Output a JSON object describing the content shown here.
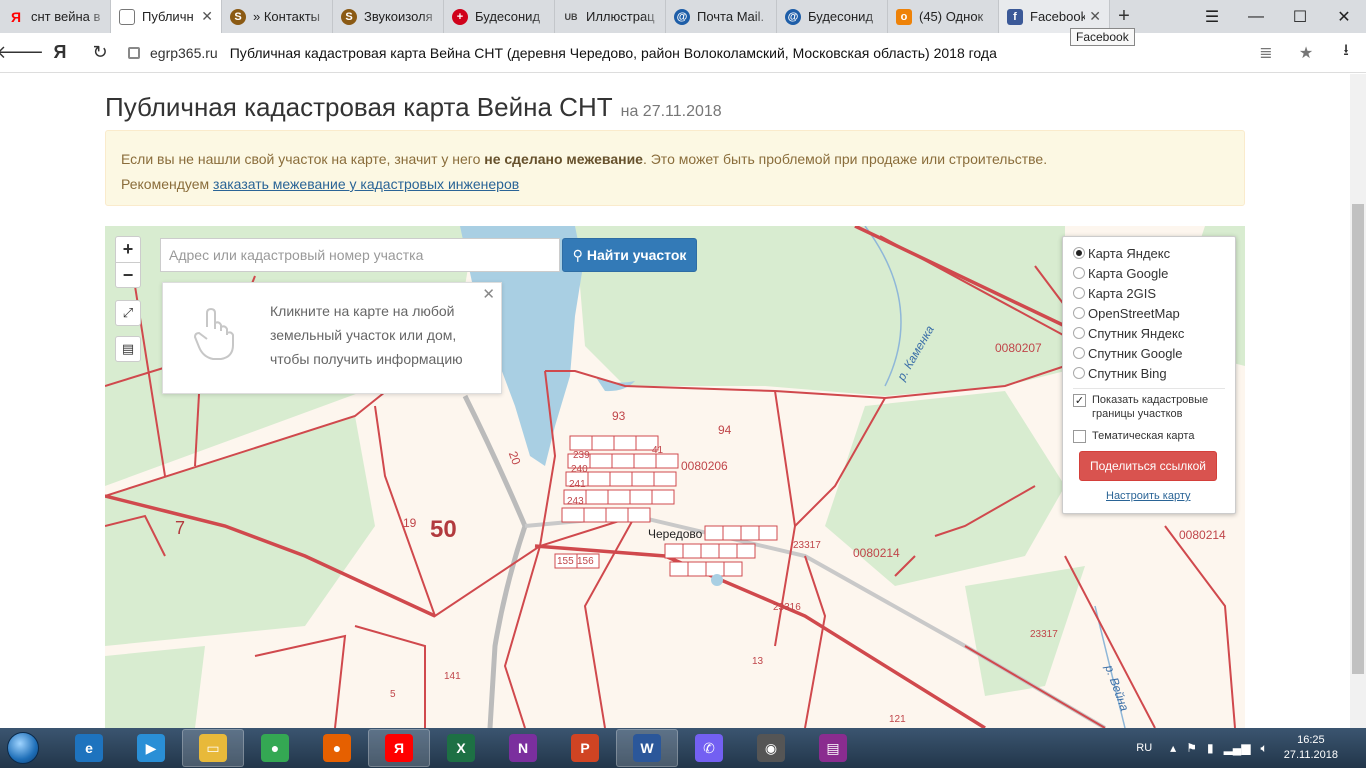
{
  "browser": {
    "tabs": [
      {
        "label": "снт вейна в",
        "icon": "yandex-icon",
        "color": "#ff0000"
      },
      {
        "label": "Публичн",
        "icon": "page-icon",
        "color": "#777777",
        "active": true
      },
      {
        "label": "» Контакты",
        "icon": "s-icon",
        "color": "#8b5a14"
      },
      {
        "label": "Звукоизоля",
        "icon": "s-icon",
        "color": "#8b5a14"
      },
      {
        "label": "Будесонид",
        "icon": "red-cross-icon",
        "color": "#d0021b"
      },
      {
        "label": "Иллюстрац",
        "icon": "ub-icon",
        "color": "#444444"
      },
      {
        "label": "Почта Mail.",
        "icon": "mail-icon",
        "color": "#1e5ea8"
      },
      {
        "label": "Будесонид",
        "icon": "mail-icon",
        "color": "#1e5ea8"
      },
      {
        "label": "(45) Однок",
        "icon": "ok-icon",
        "color": "#ee8208"
      },
      {
        "label": "Facebook",
        "icon": "facebook-icon",
        "color": "#3b5998"
      }
    ],
    "tooltip": "Facebook",
    "url_domain": "egrp365.ru",
    "url_title": "Публичная кадастровая карта Вейна СНТ (деревня Чередово, район Волоколамский, Московская область) 2018 года"
  },
  "page": {
    "title": "Публичная кадастровая карта Вейна СНТ",
    "date": "на 27.11.2018",
    "notice": {
      "line1_pre": "Если вы не нашли свой участок на карте, значит у него ",
      "line1_bold": "не сделано межевание",
      "line1_post": ". Это может быть проблемой при продаже или строительстве.",
      "line2_pre": "Рекомендуем ",
      "line2_link": "заказать межевание у кадастровых инженеров"
    }
  },
  "map": {
    "search_placeholder": "Адрес или кадастровый номер участка",
    "search_button": "Найти участок",
    "hint_text": "Кликните на карте на любой земельный участок или дом, чтобы получить информацию",
    "layers": [
      {
        "label": "Карта Яндекс",
        "selected": true
      },
      {
        "label": "Карта Google",
        "selected": false
      },
      {
        "label": "Карта 2GIS",
        "selected": false
      },
      {
        "label": "OpenStreetMap",
        "selected": false
      },
      {
        "label": "Спутник Яндекс",
        "selected": false
      },
      {
        "label": "Спутник Google",
        "selected": false
      },
      {
        "label": "Спутник Bing",
        "selected": false
      }
    ],
    "show_cadastral": "Показать кадастровые границы участков",
    "show_cadastral_checked": true,
    "thematic": "Тематическая карта",
    "thematic_checked": false,
    "share_button": "Поделиться ссылкой",
    "setup_link": "Настроить карту",
    "labels": {
      "l_0080207": "0080207",
      "l_0080206": "0080206",
      "l_0080214a": "0080214",
      "l_0080214b": "0080214",
      "l_50": "50",
      "l_7": "7",
      "l_19": "19",
      "l_93": "93",
      "l_94": "94",
      "l_20": "20",
      "l_239": "239",
      "l_240": "240",
      "l_241": "241",
      "l_243": "243",
      "l_41": "41",
      "l_155": "155",
      "l_156": "156",
      "l_23317a": "23317",
      "l_23317b": "23317",
      "l_23316": "23316",
      "l_13": "13",
      "l_141": "141",
      "l_5": "5",
      "l_121": "121",
      "village": "Чередово",
      "river_kamenka": "р. Каменка",
      "river_veyna": "р. Вейна"
    }
  },
  "taskbar": {
    "lang": "RU",
    "time": "16:25",
    "date": "27.11.2018",
    "apps": [
      {
        "name": "internet-explorer-icon",
        "color": "#1e73be",
        "glyph": "e"
      },
      {
        "name": "media-player-icon",
        "color": "#2a8fd6",
        "glyph": "▶"
      },
      {
        "name": "file-explorer-icon",
        "color": "#e8b93a",
        "glyph": "▭",
        "active": true
      },
      {
        "name": "chrome-icon",
        "color": "#34a853",
        "glyph": "●"
      },
      {
        "name": "firefox-icon",
        "color": "#e66000",
        "glyph": "●"
      },
      {
        "name": "yandex-browser-icon",
        "color": "#ff0000",
        "glyph": "Я",
        "active": true
      },
      {
        "name": "excel-icon",
        "color": "#1d7044",
        "glyph": "X"
      },
      {
        "name": "onenote-icon",
        "color": "#7b2f9e",
        "glyph": "N"
      },
      {
        "name": "powerpoint-icon",
        "color": "#d04423",
        "glyph": "P"
      },
      {
        "name": "word-icon",
        "color": "#2b579a",
        "glyph": "W",
        "active": true
      },
      {
        "name": "viber-icon",
        "color": "#7360f2",
        "glyph": "✆"
      },
      {
        "name": "camera-icon",
        "color": "#555555",
        "glyph": "◉"
      },
      {
        "name": "winrar-icon",
        "color": "#8a2c8f",
        "glyph": "▤"
      }
    ]
  }
}
